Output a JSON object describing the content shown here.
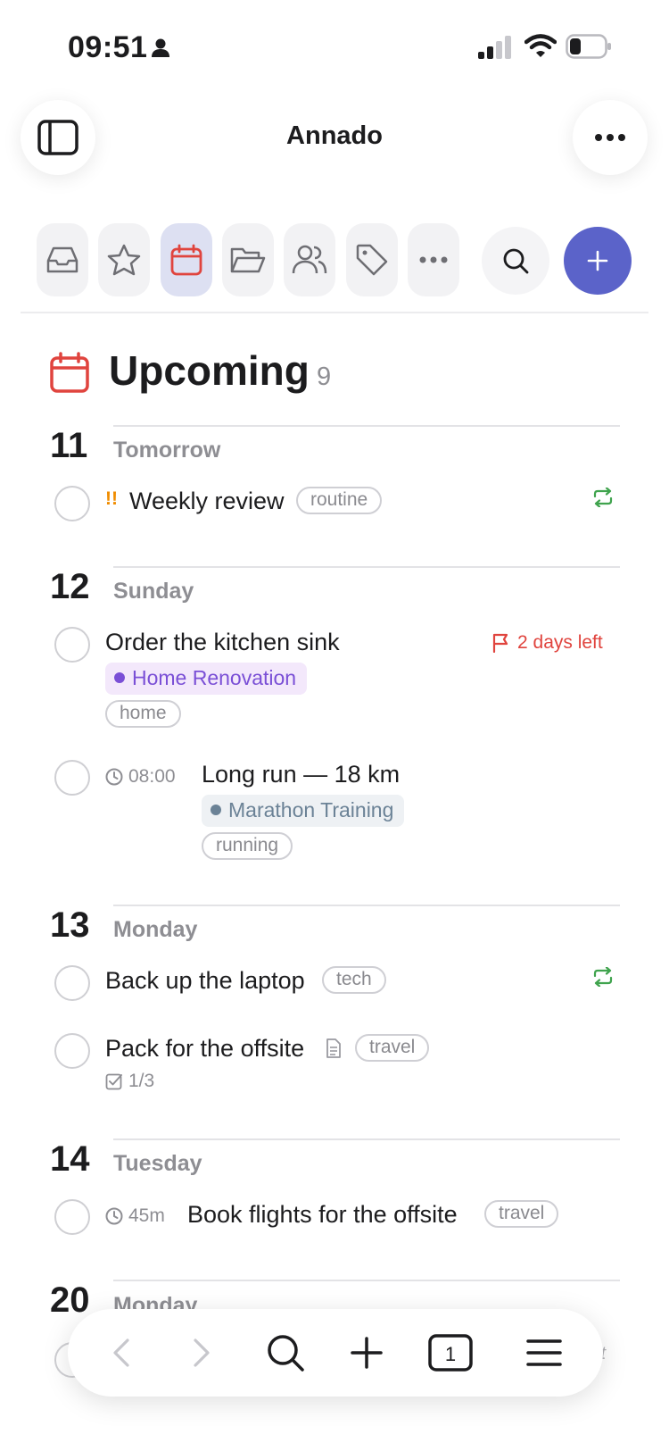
{
  "status_bar": {
    "time": "09:51"
  },
  "header": {
    "title": "Annado"
  },
  "toolbar": {
    "items": [
      {
        "name": "inbox-icon"
      },
      {
        "name": "star-icon"
      },
      {
        "name": "calendar-icon",
        "active": true
      },
      {
        "name": "folder-icon"
      },
      {
        "name": "people-icon"
      },
      {
        "name": "tag-icon"
      },
      {
        "name": "more-icon"
      }
    ],
    "search": "search-icon",
    "add": "plus-icon"
  },
  "page": {
    "title": "Upcoming",
    "count": "9"
  },
  "days": [
    {
      "num": "11",
      "name": "Tomorrow"
    },
    {
      "num": "12",
      "name": "Sunday"
    },
    {
      "num": "13",
      "name": "Monday"
    },
    {
      "num": "14",
      "name": "Tuesday"
    },
    {
      "num": "20",
      "name": "Monday"
    }
  ],
  "tasks": {
    "weekly_review": {
      "priority": "!!",
      "title": "Weekly review",
      "tag": "routine",
      "repeat": true
    },
    "kitchen_sink": {
      "title": "Order the kitchen sink",
      "deadline": "2 days left",
      "project": "Home Renovation",
      "tag": "home"
    },
    "long_run": {
      "time": "08:00",
      "title": "Long run — 18 km",
      "project": "Marathon Training",
      "tag": "running"
    },
    "backup": {
      "title": "Back up the laptop",
      "tag": "tech",
      "repeat": true
    },
    "pack": {
      "title": "Pack for the offsite",
      "tag": "travel",
      "checklist": "1/3"
    },
    "flights": {
      "duration": "45m",
      "title": "Book flights for the offsite",
      "tag": "travel"
    }
  },
  "peek": {
    "text": "ft"
  },
  "colors": {
    "accent": "#5b63c9",
    "calendar_red": "#e0443e",
    "priority_orange": "#f08c00",
    "repeat_green": "#3fa34d",
    "project_purple": "#7a4fd6",
    "project_purple_bg": "#f3e8fb",
    "project_slate": "#6b8296",
    "project_slate_bg": "#eef1f4"
  }
}
